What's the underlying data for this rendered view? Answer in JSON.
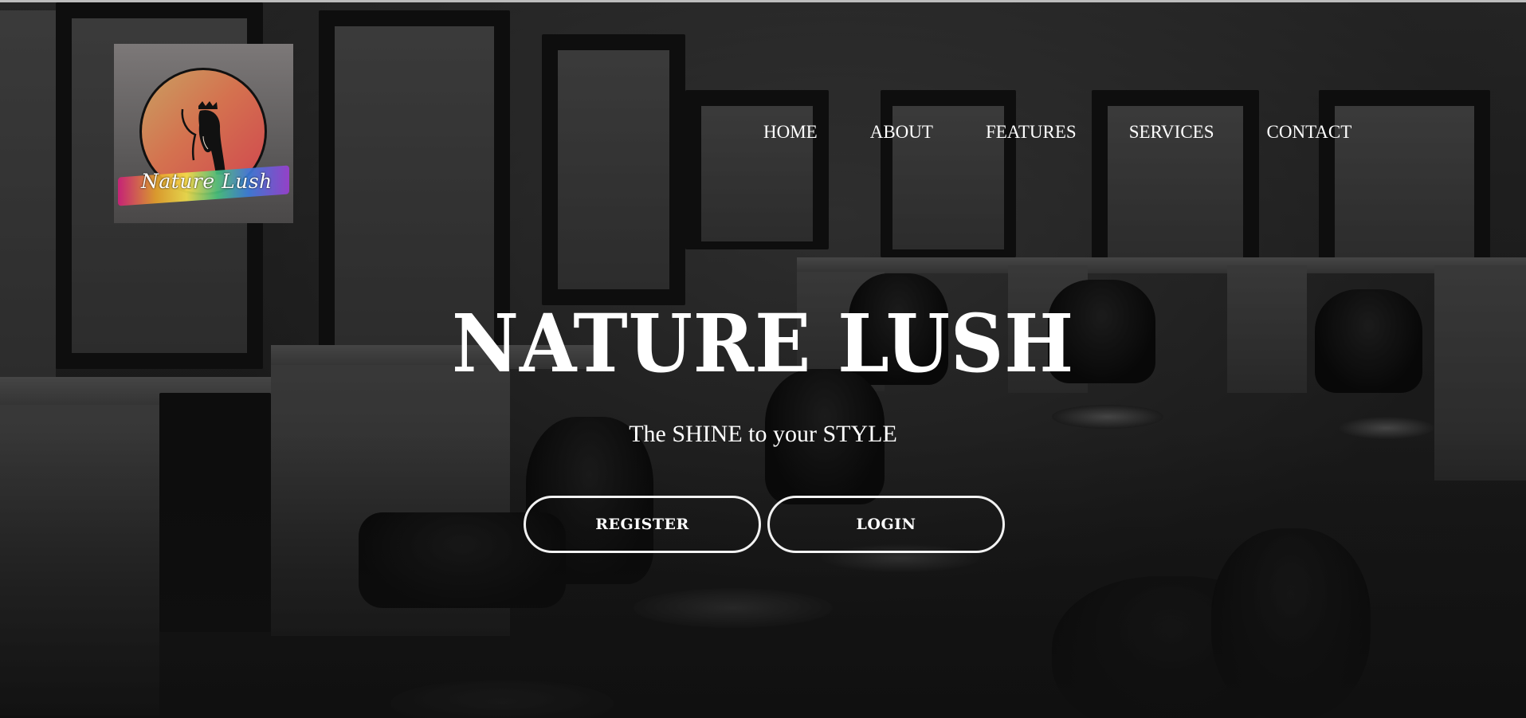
{
  "brand": {
    "logo_text": "Nature Lush",
    "logo_alt": "Nature Lush"
  },
  "nav": {
    "items": [
      {
        "label": "HOME"
      },
      {
        "label": "ABOUT"
      },
      {
        "label": "FEATURES"
      },
      {
        "label": "SERVICES"
      },
      {
        "label": "CONTACT"
      }
    ]
  },
  "hero": {
    "title": "NATURE LUSH",
    "tagline": "The SHINE to your STYLE",
    "register_label": "REGISTER",
    "login_label": "LOGIN"
  },
  "colors": {
    "text": "#ffffff",
    "button_border": "#f2f2f2",
    "overlay": "rgba(0,0,0,0.35)"
  }
}
